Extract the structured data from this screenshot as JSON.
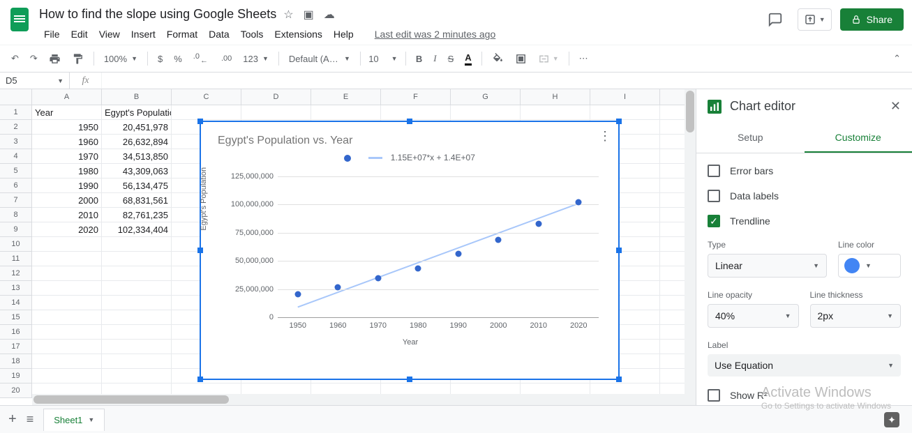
{
  "doc": {
    "title": "How to find the slope using Google Sheets",
    "last_edit": "Last edit was 2 minutes ago"
  },
  "menubar": [
    "File",
    "Edit",
    "View",
    "Insert",
    "Format",
    "Data",
    "Tools",
    "Extensions",
    "Help"
  ],
  "share": "Share",
  "toolbar": {
    "zoom": "100%",
    "font": "Default (Ari...",
    "size": "10",
    "decimals": [
      "$",
      "%",
      ".0",
      ".00",
      "123"
    ]
  },
  "namebox": "D5",
  "columns": [
    "A",
    "B",
    "C",
    "D",
    "E",
    "F",
    "G",
    "H",
    "I"
  ],
  "rows": 20,
  "table": {
    "headers": [
      "Year",
      "Egypt's Population"
    ],
    "data": [
      [
        "1950",
        "20,451,978"
      ],
      [
        "1960",
        "26,632,894"
      ],
      [
        "1970",
        "34,513,850"
      ],
      [
        "1980",
        "43,309,063"
      ],
      [
        "1990",
        "56,134,475"
      ],
      [
        "2000",
        "68,831,561"
      ],
      [
        "2010",
        "82,761,235"
      ],
      [
        "2020",
        "102,334,404"
      ]
    ]
  },
  "chart_data": {
    "type": "scatter",
    "title": "Egypt's Population vs. Year",
    "xlabel": "Year",
    "ylabel": "Egypt's Population",
    "x": [
      1950,
      1960,
      1970,
      1980,
      1990,
      2000,
      2010,
      2020
    ],
    "y": [
      20451978,
      26632894,
      34513850,
      43309063,
      56134475,
      68831561,
      82761235,
      102334404
    ],
    "xlim": [
      1945,
      2025
    ],
    "ylim": [
      0,
      130000000
    ],
    "y_ticks": [
      0,
      25000000,
      50000000,
      75000000,
      100000000,
      125000000
    ],
    "y_tick_labels": [
      "0",
      "25,000,000",
      "50,000,000",
      "75,000,000",
      "100,000,000",
      "125,000,000"
    ],
    "x_ticks": [
      1950,
      1960,
      1970,
      1980,
      1990,
      2000,
      2010,
      2020
    ],
    "trendline": {
      "slope": 11500000.0,
      "intercept": 14000000.0,
      "equation": "1.15E+07*x + 1.4E+07"
    }
  },
  "panel": {
    "title": "Chart editor",
    "tabs": {
      "setup": "Setup",
      "customize": "Customize"
    },
    "checks": {
      "error_bars": "Error bars",
      "data_labels": "Data labels",
      "trendline": "Trendline",
      "show_r2": "Show R²"
    },
    "labels": {
      "type": "Type",
      "line_color": "Line color",
      "line_opacity": "Line opacity",
      "line_thickness": "Line thickness",
      "label": "Label"
    },
    "values": {
      "type": "Linear",
      "opacity": "40%",
      "thickness": "2px",
      "label": "Use Equation"
    }
  },
  "sheet_tab": "Sheet1",
  "watermark": {
    "line1": "Activate Windows",
    "line2": "Go to Settings to activate Windows"
  }
}
